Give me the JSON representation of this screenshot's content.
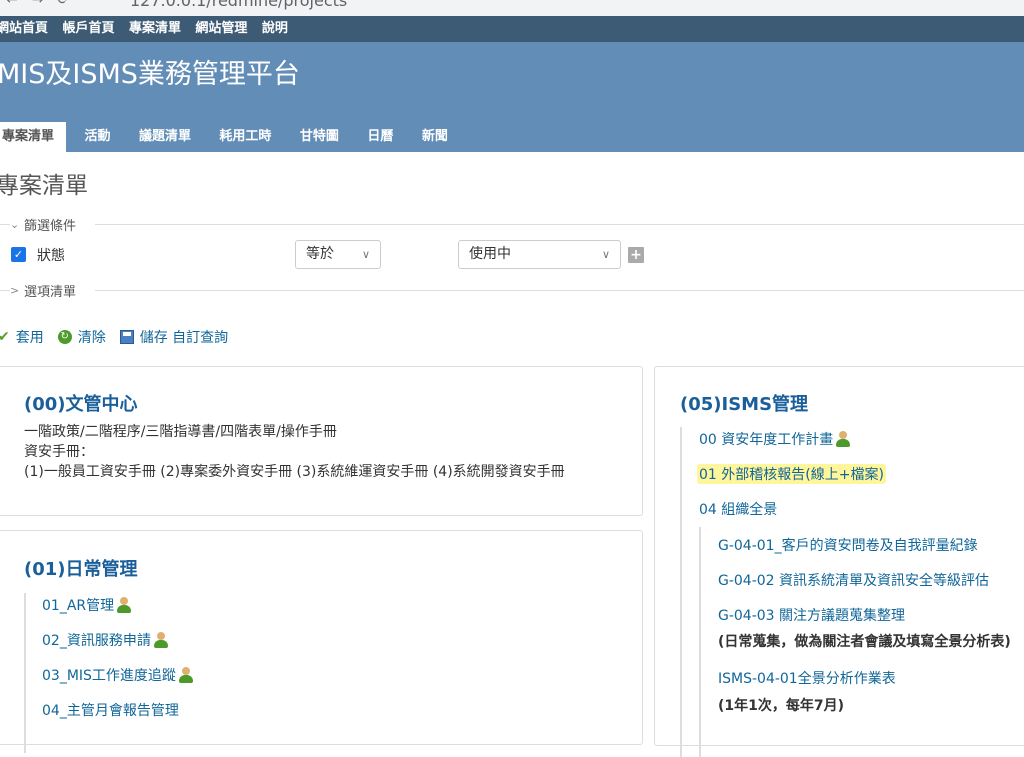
{
  "browser": {
    "url": "127.0.0.1/redmine/projects"
  },
  "top_menu": [
    "網站首頁",
    "帳戶首頁",
    "專案清單",
    "網站管理",
    "說明"
  ],
  "header": {
    "title": "MIS及ISMS業務管理平台"
  },
  "tabs": [
    {
      "label": "專案清單",
      "selected": true
    },
    {
      "label": "活動"
    },
    {
      "label": "議題清單"
    },
    {
      "label": "耗用工時"
    },
    {
      "label": "甘特圖"
    },
    {
      "label": "日曆"
    },
    {
      "label": "新聞"
    }
  ],
  "page_title": "專案清單",
  "filters": {
    "legend": "篩選條件",
    "status_label": "狀態",
    "operator": "等於",
    "value": "使用中"
  },
  "options": {
    "legend": "選項清單"
  },
  "actions": {
    "apply": "套用",
    "clear": "清除",
    "save": "儲存 自訂查詢"
  },
  "projects": {
    "doc_center": {
      "title": "(00)文管中心",
      "desc": [
        "一階政策/二階程序/三階指導書/四階表單/操作手冊",
        "資安手冊：",
        "(1)一般員工資安手冊 (2)專案委外資安手冊 (3)系統維運資安手冊 (4)系統開發資安手冊"
      ]
    },
    "daily": {
      "title": "(01)日常管理",
      "items": [
        "01_AR管理",
        "02_資訊服務申請",
        "03_MIS工作進度追蹤",
        "04_主管月會報告管理"
      ]
    },
    "isms": {
      "title": "(05)ISMS管理",
      "items": [
        "00 資安年度工作計畫",
        "01 外部稽核報告(線上+檔案)",
        "04 組織全景"
      ],
      "sub_items": [
        "G-04-01_客戶的資安問卷及自我評量紀錄",
        "G-04-02 資訊系統清單及資訊安全等級評估",
        "G-04-03 關注方議題蒐集整理",
        "ISMS-04-01全景分析作業表"
      ],
      "notes": [
        "(日常蒐集，做為關注者會議及填寫全景分析表)",
        "(1年1次，每年7月)"
      ]
    }
  },
  "colors": {
    "top_menu_bg": "#3e5b76",
    "header_bg": "#628db6",
    "link": "#169",
    "highlight": "#fff59a"
  }
}
